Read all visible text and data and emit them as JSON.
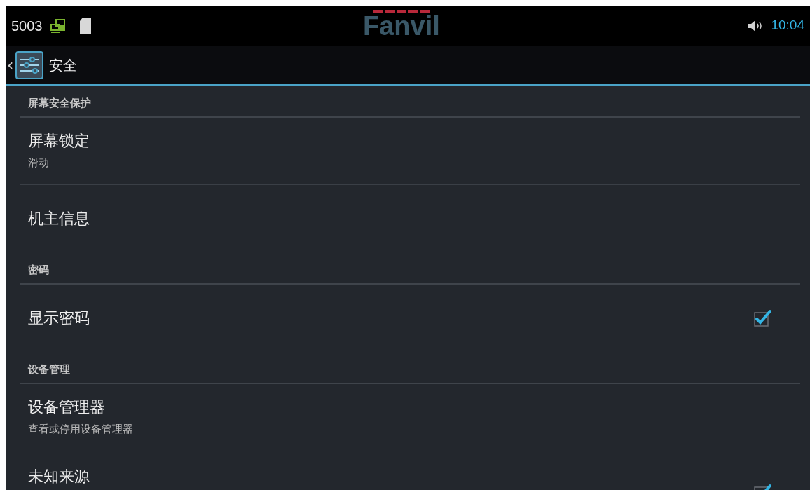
{
  "status_bar": {
    "extension": "5003",
    "logo": "Fanvil",
    "time": "10:04"
  },
  "action_bar": {
    "back": "‹",
    "title": "安全"
  },
  "list": [
    {
      "kind": "header",
      "title": "屏幕安全保护"
    },
    {
      "kind": "item",
      "title": "屏幕锁定",
      "summary": "滑动"
    },
    {
      "kind": "item",
      "title": "机主信息"
    },
    {
      "kind": "header",
      "title": "密码"
    },
    {
      "kind": "checkbox",
      "title": "显示密码",
      "checked": true
    },
    {
      "kind": "header",
      "title": "设备管理"
    },
    {
      "kind": "item",
      "title": "设备管理器",
      "summary": "查看或停用设备管理器"
    },
    {
      "kind": "checkbox",
      "title": "未知来源",
      "checked": true
    }
  ]
}
